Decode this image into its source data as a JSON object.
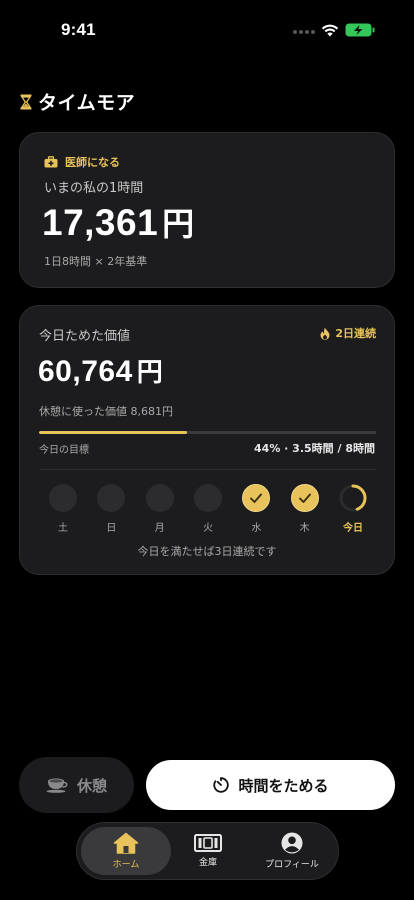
{
  "status_bar": {
    "time": "9:41"
  },
  "app": {
    "title": "タイムモア"
  },
  "goal_card": {
    "tag": "医師になる",
    "subtitle": "いまの私の1時間",
    "value": "17,361",
    "unit": "円",
    "basis": "1日8時間 × 2年基準"
  },
  "today_card": {
    "label": "今日ためた価値",
    "streak": "2日連続",
    "value": "60,764",
    "unit": "円",
    "break_used": "休憩に使った価値 8,681円",
    "goal_label": "今日の目標",
    "goal_stat": "44% · 3.5時間 / 8時間",
    "progress": 0.44,
    "days": [
      {
        "label": "土",
        "state": "empty"
      },
      {
        "label": "日",
        "state": "empty"
      },
      {
        "label": "月",
        "state": "empty"
      },
      {
        "label": "火",
        "state": "empty"
      },
      {
        "label": "水",
        "state": "done"
      },
      {
        "label": "木",
        "state": "done"
      },
      {
        "label": "今日",
        "state": "today"
      }
    ],
    "hint": "今日を満たせば3日連続です"
  },
  "actions": {
    "break_label": "休憩",
    "start_label": "時間をためる"
  },
  "tabs": [
    {
      "label": "ホーム",
      "icon": "home-icon",
      "active": true
    },
    {
      "label": "金庫",
      "icon": "safe-icon",
      "active": false
    },
    {
      "label": "プロフィール",
      "icon": "profile-icon",
      "active": false
    }
  ],
  "colors": {
    "accent": "#e8c25a",
    "card": "#1c1c1e",
    "background": "#000000"
  }
}
